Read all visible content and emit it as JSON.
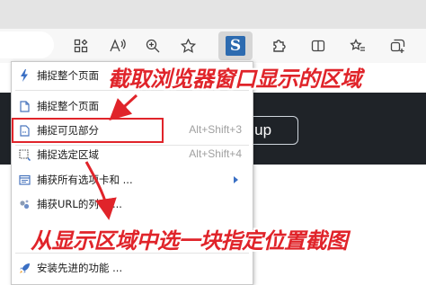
{
  "toolbar": {
    "icons": [
      "apps-icon",
      "read-aloud-icon",
      "zoom-icon",
      "favorite-star-icon",
      "screenshot-extension-icon",
      "extensions-puzzle-icon",
      "split-screen-icon",
      "favorites-list-icon",
      "collections-icon"
    ],
    "extension_logo_text": "S",
    "accent": "#2d6bb0"
  },
  "page": {
    "signup_text": "n up"
  },
  "menu": {
    "items": [
      {
        "label": "捕捉整个页面",
        "shortcut": "",
        "icon": "lightning-icon"
      },
      {
        "label": "捕捉整个页面",
        "shortcut": "",
        "icon": "document-icon"
      },
      {
        "label": "捕捉可见部分",
        "shortcut": "Alt+Shift+3",
        "icon": "visible-part-icon"
      },
      {
        "label": "捕捉选定区域",
        "shortcut": "Alt+Shift+4",
        "icon": "selection-area-icon"
      },
      {
        "label": "捕获所有选项卡和 ...",
        "shortcut": "",
        "icon": "tabs-icon"
      },
      {
        "label": "捕获URL的列表 ...",
        "shortcut": "",
        "icon": "url-list-icon"
      },
      {
        "label": "安装先进的功能 ...",
        "shortcut": "",
        "icon": "rocket-icon"
      }
    ]
  },
  "annotations": {
    "top": "截取浏览器窗口显示的区域",
    "bottom": "从显示区域中选一块指定位置截图",
    "color": "#e0242a"
  }
}
